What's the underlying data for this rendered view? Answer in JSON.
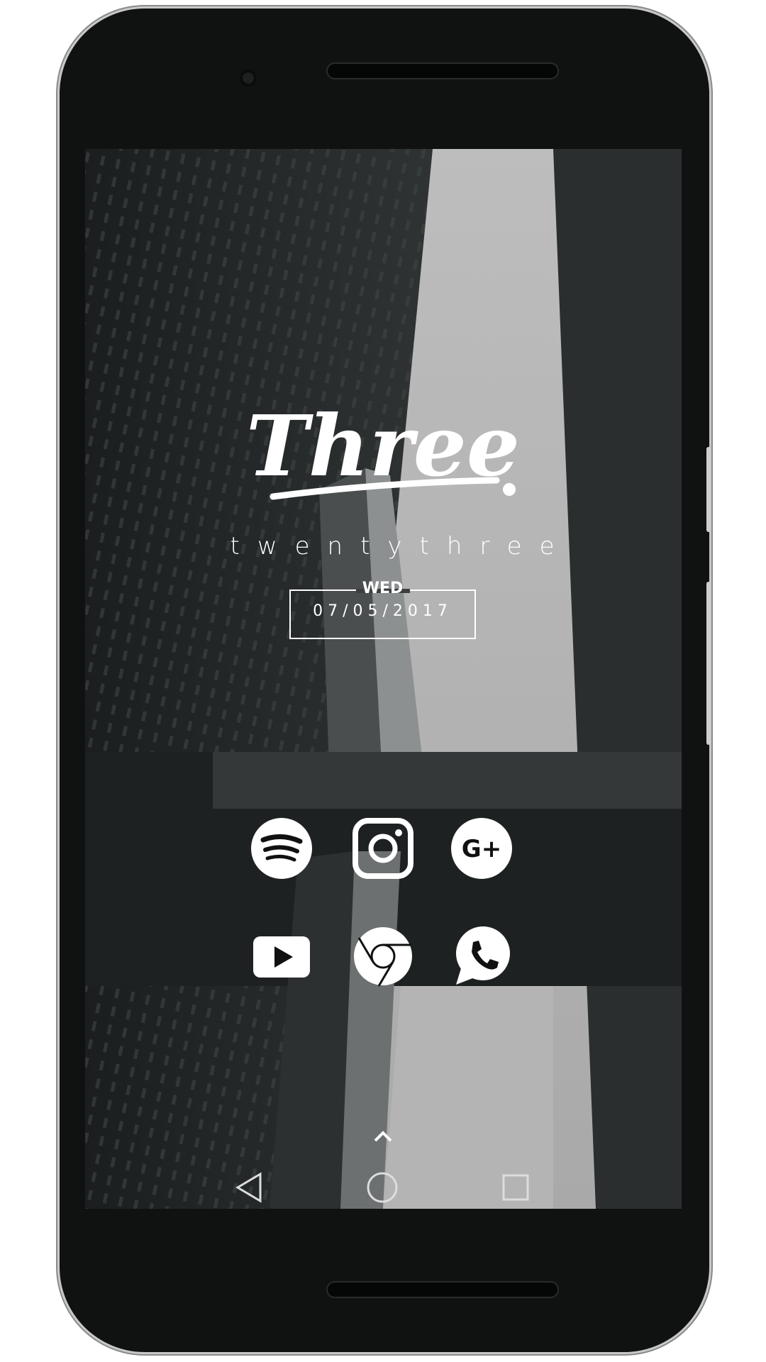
{
  "lockscreen": {
    "hour_script": "Three",
    "minutes_text": "twentythree",
    "day": "WED",
    "date": "07/05/2017"
  },
  "apps": [
    {
      "name": "Spotify",
      "icon": "spotify-icon"
    },
    {
      "name": "Instagram",
      "icon": "instagram-icon"
    },
    {
      "name": "Google+",
      "icon": "google-plus-icon",
      "label": "G+"
    },
    {
      "name": "YouTube",
      "icon": "youtube-icon"
    },
    {
      "name": "Chrome",
      "icon": "chrome-icon"
    },
    {
      "name": "WhatsApp",
      "icon": "whatsapp-icon"
    }
  ],
  "navigation": {
    "app_drawer": "chevron-up-icon",
    "back": "back-triangle-icon",
    "home": "home-circle-icon",
    "recents": "recents-square-icon"
  },
  "colors": {
    "icon": "#ffffff",
    "device": "#101212"
  }
}
